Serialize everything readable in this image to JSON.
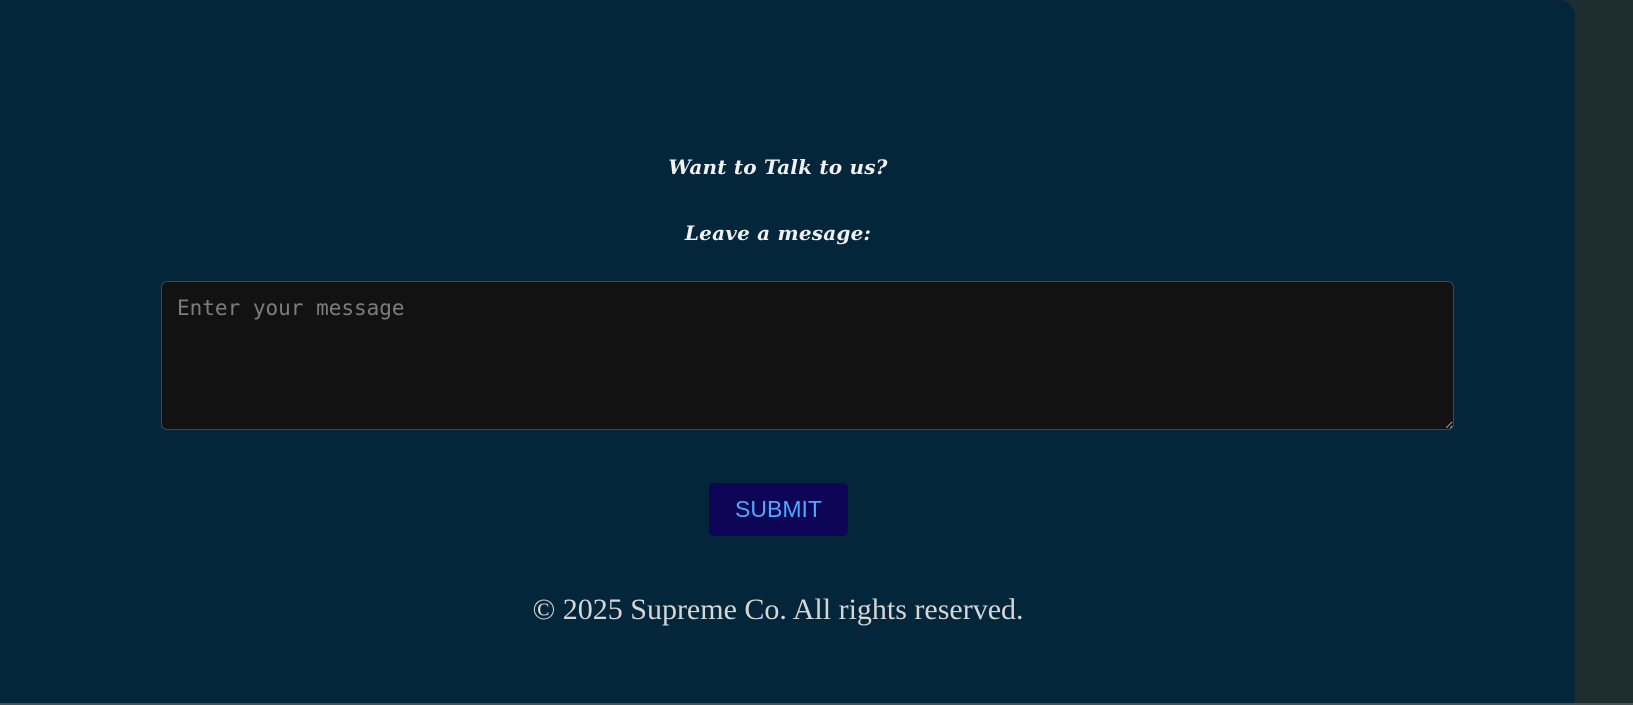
{
  "contact": {
    "heading": "Want to Talk to us?",
    "subheading": "Leave a mesage:",
    "message_placeholder": "Enter your message",
    "message_value": "",
    "submit_label": "SUBMIT"
  },
  "footer": {
    "copyright": "© 2025 Supreme Co. All rights reserved."
  },
  "colors": {
    "background": "#03263a",
    "textarea_background": "#121212",
    "button_background": "#0f0557",
    "button_text": "#4fa8ff"
  }
}
